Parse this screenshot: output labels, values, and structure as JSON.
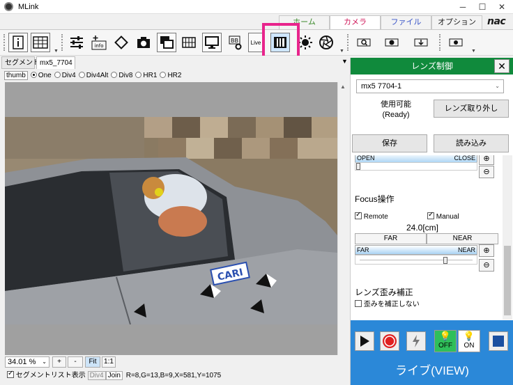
{
  "window": {
    "title": "MLink",
    "min": "─",
    "max": "☐",
    "close": "✕"
  },
  "ribbon": {
    "tabs": [
      {
        "label": "ホーム"
      },
      {
        "label": "カメラ"
      },
      {
        "label": "ファイル"
      },
      {
        "label": "オプション"
      }
    ],
    "logo": "nac"
  },
  "toolbar": {
    "info_label": "info",
    "live_label": "Live",
    "bb_label": "BB"
  },
  "segment": {
    "tabs": [
      "セグメント",
      "mx5_7704"
    ]
  },
  "thumb": {
    "label": "thumb",
    "options": [
      "One",
      "Div4",
      "Div4Alt",
      "Div8",
      "HR1",
      "HR2"
    ],
    "selected": "One"
  },
  "viewer": {
    "sticker": "CARI"
  },
  "bottom": {
    "zoom": "34.01 %",
    "plus": "+",
    "minus": "-",
    "fit": "Fit",
    "one_to_one": "1:1",
    "seglist_label": "セグメントリスト表示",
    "div4": "Div4",
    "join": "Join",
    "pixel_info": "R=8,G=13,B=9,X=581,Y=1075"
  },
  "lens_panel": {
    "title": "レンズ制御",
    "close": "✕",
    "lens_select": "mx5 7704-1",
    "status_line1": "使用可能",
    "status_line2": "(Ready)",
    "detach_button": "レンズ取り外し",
    "save_button": "保存",
    "load_button": "読み込み",
    "iris": {
      "open": "OPEN",
      "close": "CLOSE"
    },
    "focus": {
      "title": "Focus操作",
      "remote": "Remote",
      "manual": "Manual",
      "value": "24.0[cm]",
      "far_button": "FAR",
      "near_button": "NEAR",
      "far": "FAR",
      "near": "NEAR",
      "position": 0.76
    },
    "distortion": {
      "title": "レンズ歪み補正",
      "option": "歪みを補正しない"
    },
    "live": {
      "off": "OFF",
      "on": "ON",
      "label": "ライブ(VIEW)"
    }
  }
}
